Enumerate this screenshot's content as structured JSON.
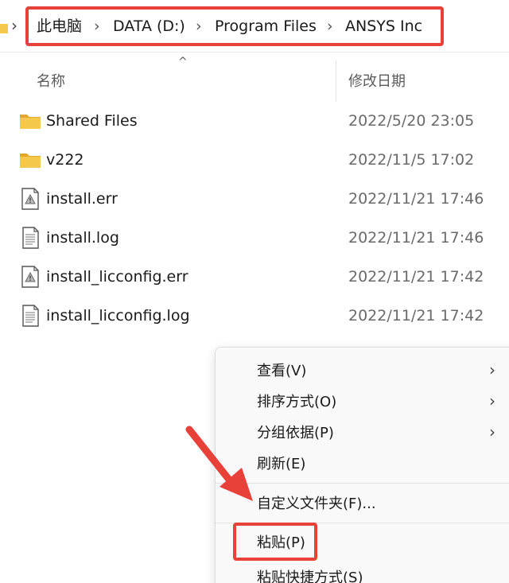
{
  "breadcrumb": {
    "items": [
      {
        "label": "此电脑"
      },
      {
        "label": "DATA (D:)"
      },
      {
        "label": "Program Files"
      },
      {
        "label": "ANSYS Inc"
      }
    ],
    "separator": "›"
  },
  "columns": {
    "name": "名称",
    "date": "修改日期",
    "sort_indicator": "^"
  },
  "files": [
    {
      "name": "Shared Files",
      "date": "2022/5/20 23:05",
      "icon": "folder-icon"
    },
    {
      "name": "v222",
      "date": "2022/11/5 17:02",
      "icon": "folder-icon"
    },
    {
      "name": "install.err",
      "date": "2022/11/21 17:46",
      "icon": "error-file-icon"
    },
    {
      "name": "install.log",
      "date": "2022/11/21 17:46",
      "icon": "text-file-icon"
    },
    {
      "name": "install_licconfig.err",
      "date": "2022/11/21 17:42",
      "icon": "error-file-icon"
    },
    {
      "name": "install_licconfig.log",
      "date": "2022/11/21 17:42",
      "icon": "text-file-icon"
    }
  ],
  "context_menu": {
    "items": [
      {
        "label": "查看(V)",
        "submenu": true
      },
      {
        "label": "排序方式(O)",
        "submenu": true
      },
      {
        "label": "分组依据(P)",
        "submenu": true
      },
      {
        "label": "刷新(E)",
        "submenu": false
      },
      {
        "label": "自定义文件夹(F)...",
        "submenu": false
      },
      {
        "label": "粘贴(P)",
        "submenu": false
      },
      {
        "label": "粘贴快捷方式(S)",
        "submenu": false
      }
    ],
    "submenu_arrow": "›"
  },
  "colors": {
    "highlight": "#e8413a",
    "folder": "#f4c84a",
    "folder_dark": "#e0a92a"
  }
}
